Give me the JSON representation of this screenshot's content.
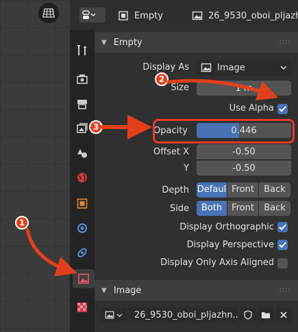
{
  "header": {
    "object_name": "Empty",
    "image_name": "26_9530_oboi_pljazh"
  },
  "panel": {
    "empty_section_title": "Empty",
    "display_as_label": "Display As",
    "display_as_value": "Image",
    "size_label": "Size",
    "size_value": "1 m",
    "use_alpha_label": "Use Alpha",
    "opacity_label": "Opacity",
    "opacity_value": "0.446",
    "opacity_fraction": 0.446,
    "offset_x_label": "Offset X",
    "offset_x_value": "-0.50",
    "offset_y_label": "Y",
    "offset_y_value": "-0.50",
    "depth_label": "Depth",
    "depth_options": [
      "Defaul",
      "Front",
      "Back"
    ],
    "side_label": "Side",
    "side_options": [
      "Both",
      "Front",
      "Back"
    ],
    "display_ortho_label": "Display Orthographic",
    "display_persp_label": "Display Perspective",
    "display_axis_label": "Display Only Axis Aligned",
    "image_section_title": "Image",
    "image_file_name": "26_9530_oboi_pljazhn.."
  },
  "annotations": {
    "badge_1": "1",
    "badge_2": "2",
    "badge_3": "3"
  },
  "colors": {
    "accent_blue": "#4772b3",
    "annotation_red": "#e2401c"
  }
}
